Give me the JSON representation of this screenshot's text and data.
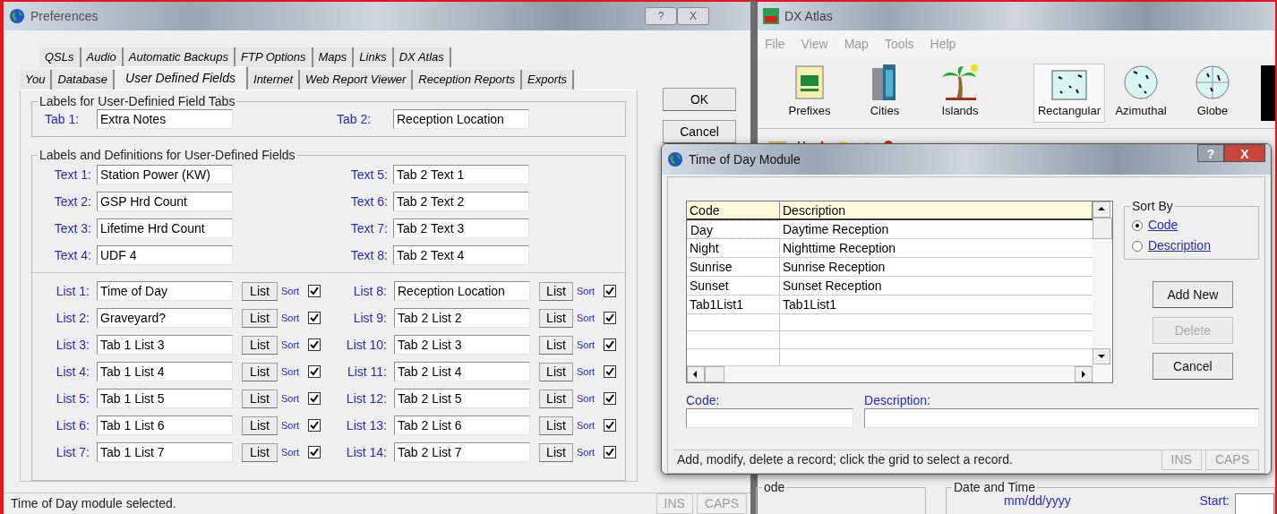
{
  "preferences": {
    "title": "Preferences",
    "title_buttons": [
      "?",
      "X"
    ],
    "tab_rows": [
      [
        {
          "label": "QSLs",
          "selected": false
        },
        {
          "label": "Audio",
          "selected": false
        },
        {
          "label": "Automatic Backups",
          "selected": false
        },
        {
          "label": "FTP Options",
          "selected": false
        },
        {
          "label": "Maps",
          "selected": false
        },
        {
          "label": "Links",
          "selected": false
        },
        {
          "label": "DX Atlas",
          "selected": false
        }
      ],
      [
        {
          "label": "You",
          "selected": false
        },
        {
          "label": "Database",
          "selected": false
        },
        {
          "label": "User Defined Fields",
          "selected": true
        },
        {
          "label": "Internet",
          "selected": false
        },
        {
          "label": "Web Report Viewer",
          "selected": false
        },
        {
          "label": "Reception Reports",
          "selected": false
        },
        {
          "label": "Exports",
          "selected": false
        }
      ]
    ],
    "tab_labels": {
      "title": "Labels for User-Definied Field Tabs",
      "fields": [
        {
          "label": "Tab 1:",
          "value": "Extra Notes"
        },
        {
          "label": "Tab 2:",
          "value": "Reception Location"
        }
      ]
    },
    "text_fields": {
      "title": "Labels and Definitions for User-Defined Fields",
      "fields": [
        {
          "label": "Text 1:",
          "value": "Station Power (KW)"
        },
        {
          "label": "Text 2:",
          "value": "GSP Hrd Count"
        },
        {
          "label": "Text 3:",
          "value": "Lifetime Hrd Count"
        },
        {
          "label": "Text 4:",
          "value": "UDF 4"
        },
        {
          "label": "Text 5:",
          "value": "Tab 2 Text 1"
        },
        {
          "label": "Text 6:",
          "value": "Tab 2 Text 2"
        },
        {
          "label": "Text 7:",
          "value": "Tab 2 Text 3"
        },
        {
          "label": "Text 8:",
          "value": "Tab 2 Text 4"
        }
      ]
    },
    "lists": [
      {
        "label": "List 1:",
        "value": "Time of Day",
        "button": "List",
        "sort": "Sort",
        "checked": true
      },
      {
        "label": "List 2:",
        "value": "Graveyard?",
        "button": "List",
        "sort": "Sort",
        "checked": true
      },
      {
        "label": "List 3:",
        "value": "Tab 1 List 3",
        "button": "List",
        "sort": "Sort",
        "checked": true
      },
      {
        "label": "List 4:",
        "value": "Tab 1 List 4",
        "button": "List",
        "sort": "Sort",
        "checked": true
      },
      {
        "label": "List 5:",
        "value": "Tab 1 List 5",
        "button": "List",
        "sort": "Sort",
        "checked": true
      },
      {
        "label": "List 6:",
        "value": "Tab 1 List 6",
        "button": "List",
        "sort": "Sort",
        "checked": true
      },
      {
        "label": "List 7:",
        "value": "Tab 1 List 7",
        "button": "List",
        "sort": "Sort",
        "checked": true
      },
      {
        "label": "List 8:",
        "value": "Reception Location",
        "button": "List",
        "sort": "Sort",
        "checked": true
      },
      {
        "label": "List 9:",
        "value": "Tab 2 List 2",
        "button": "List",
        "sort": "Sort",
        "checked": true
      },
      {
        "label": "List 10:",
        "value": "Tab 2 List 3",
        "button": "List",
        "sort": "Sort",
        "checked": true
      },
      {
        "label": "List 11:",
        "value": "Tab 2 List 4",
        "button": "List",
        "sort": "Sort",
        "checked": true
      },
      {
        "label": "List 12:",
        "value": "Tab 2 List 5",
        "button": "List",
        "sort": "Sort",
        "checked": true
      },
      {
        "label": "List 13:",
        "value": "Tab 2 List 6",
        "button": "List",
        "sort": "Sort",
        "checked": true
      },
      {
        "label": "List 14:",
        "value": "Tab 2 List 7",
        "button": "List",
        "sort": "Sort",
        "checked": true
      }
    ],
    "buttons": [
      "OK",
      "Cancel"
    ],
    "status_bar": {
      "message": "Time of Day module selected.",
      "indicators": [
        "INS",
        "CAPS"
      ]
    }
  },
  "dx_atlas": {
    "title": "DX Atlas",
    "menu": [
      "File",
      "View",
      "Map",
      "Tools",
      "Help"
    ],
    "toolbar": [
      {
        "kind": "prefixes",
        "label": "Prefixes",
        "selected": false
      },
      {
        "kind": "cities",
        "label": "Cities",
        "selected": false
      },
      {
        "kind": "islands",
        "label": "Islands",
        "selected": false
      },
      {
        "kind": "rectangular",
        "label": "Rectangular",
        "selected": true
      },
      {
        "kind": "azimuthal",
        "label": "Azimuthal",
        "selected": false
      },
      {
        "kind": "globe",
        "label": "Globe",
        "selected": false
      }
    ],
    "group_1": {
      "title": "ode"
    },
    "group_2": {
      "title": "Date and Time",
      "format": "mm/dd/yyyy",
      "start_label": "Start:"
    }
  },
  "dialog": {
    "title": "Time of Day Module",
    "title_buttons": [
      "?",
      "X"
    ],
    "grid": {
      "columns": [
        "Code",
        "Description"
      ],
      "rows": [
        {
          "code": "Day",
          "description": "Daytime Reception"
        },
        {
          "code": "Night",
          "description": "Nighttime Reception"
        },
        {
          "code": "Sunrise",
          "description": "Sunrise Reception"
        },
        {
          "code": "Sunset",
          "description": "Sunset Reception"
        },
        {
          "code": "Tab1List1",
          "description": "Tab1List1"
        }
      ]
    },
    "sort_by": {
      "title": "Sort By",
      "options": [
        {
          "label": "Code",
          "selected": true
        },
        {
          "label": "Description",
          "selected": false
        }
      ]
    },
    "buttons": [
      {
        "label": "Add New",
        "disabled": false
      },
      {
        "label": "Delete",
        "disabled": true
      },
      {
        "label": "Cancel",
        "disabled": false
      }
    ],
    "fields": [
      {
        "label": "Code:"
      },
      {
        "label": "Description:"
      }
    ],
    "status_bar": {
      "message": "Add, modify, delete a record; click the grid to select a record.",
      "indicators": [
        "INS",
        "CAPS"
      ]
    }
  }
}
